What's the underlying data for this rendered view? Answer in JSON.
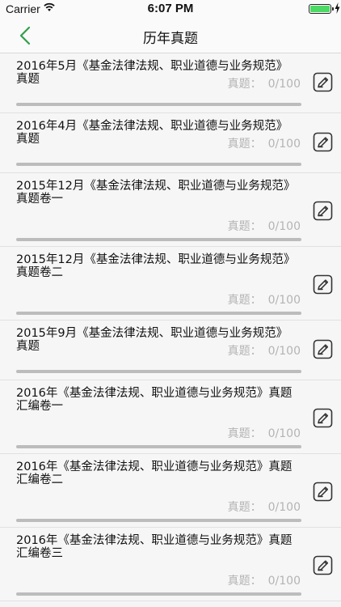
{
  "status_bar": {
    "carrier": "Carrier",
    "time": "6:07 PM",
    "battery_level": 1.0
  },
  "nav": {
    "title": "历年真题",
    "back_icon": "chevron-left-icon"
  },
  "colors": {
    "accent": "#2ea04a",
    "progress_track": "#bcbcbc",
    "score_text": "#b4b4b4"
  },
  "items": [
    {
      "title": "2016年5月《基金法律法规、职业道德与业务规范》真题",
      "score_label": "真题：",
      "score": "0/100",
      "progress": 0
    },
    {
      "title": "2016年4月《基金法律法规、职业道德与业务规范》真题",
      "score_label": "真题：",
      "score": "0/100",
      "progress": 0
    },
    {
      "title": "2015年12月《基金法律法规、职业道德与业务规范》真题卷一",
      "score_label": "真题：",
      "score": "0/100",
      "progress": 0
    },
    {
      "title": "2015年12月《基金法律法规、职业道德与业务规范》真题卷二",
      "score_label": "真题：",
      "score": "0/100",
      "progress": 0
    },
    {
      "title": "2015年9月《基金法律法规、职业道德与业务规范》真题",
      "score_label": "真题：",
      "score": "0/100",
      "progress": 0
    },
    {
      "title": "2016年《基金法律法规、职业道德与业务规范》真题汇编卷一",
      "score_label": "真题：",
      "score": "0/100",
      "progress": 0
    },
    {
      "title": "2016年《基金法律法规、职业道德与业务规范》真题汇编卷二",
      "score_label": "真题：",
      "score": "0/100",
      "progress": 0
    },
    {
      "title": "2016年《基金法律法规、职业道德与业务规范》真题汇编卷三",
      "score_label": "真题：",
      "score": "0/100",
      "progress": 0
    }
  ]
}
